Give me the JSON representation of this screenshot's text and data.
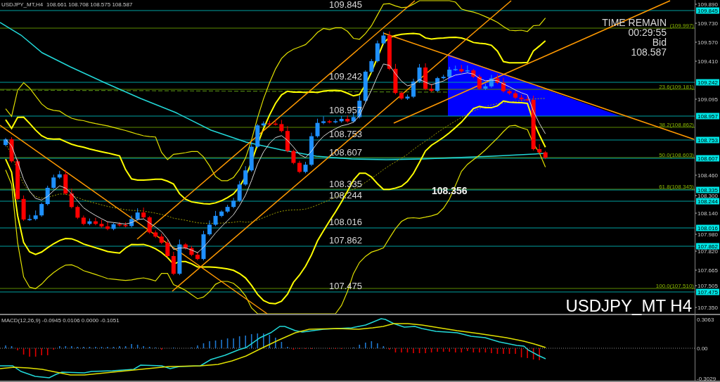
{
  "header": {
    "symbol": "USDJPY_MT,H4",
    "ohlc": "108.661 108.708 108.575 108.587"
  },
  "price_chart": {
    "price_levels": [
      {
        "label": "109.845",
        "axis_tag": "109.845"
      },
      {
        "label": "109.242",
        "axis_tag": "109.242"
      },
      {
        "label": "108.957",
        "axis_tag": "108.957"
      },
      {
        "label": "108.753",
        "axis_tag": "108.753"
      },
      {
        "label": "108.607",
        "axis_tag": "108.607"
      },
      {
        "label": "108.335",
        "axis_tag": "108.335"
      },
      {
        "label": "108.244",
        "axis_tag": "108.244"
      },
      {
        "label": "108.016",
        "axis_tag": "108.016"
      },
      {
        "label": "107.862",
        "axis_tag": "107.862"
      },
      {
        "label": "107.475",
        "axis_tag": "107.475"
      }
    ],
    "fibonacci_levels": [
      {
        "label": "(109.997)"
      },
      {
        "label": "23.6(109.181)"
      },
      {
        "label": "38.2(108.862)"
      },
      {
        "label": "50.0(108.603)"
      },
      {
        "label": "61.8(108.345)"
      },
      {
        "label": "100.0(107.510)"
      }
    ],
    "price_marker": "108.356",
    "timer": {
      "title": "TIME REMAIN",
      "countdown": "00:29:55",
      "quote_label": "Bid",
      "quote": "108.587"
    },
    "symbol_label": "USDJPY_MT H4",
    "price_axis": [
      "109.890",
      "109.730",
      "109.570",
      "109.410",
      "109.095",
      "108.460",
      "108.300",
      "108.140",
      "107.980",
      "107.820",
      "107.665",
      "107.505",
      "107.350"
    ]
  },
  "macd": {
    "title": "MACD(12,26,9) -0.0945 0.0106 0.0000 -0.1051",
    "axis": [
      "0.3063",
      "0.00",
      "-0.3029"
    ]
  }
}
